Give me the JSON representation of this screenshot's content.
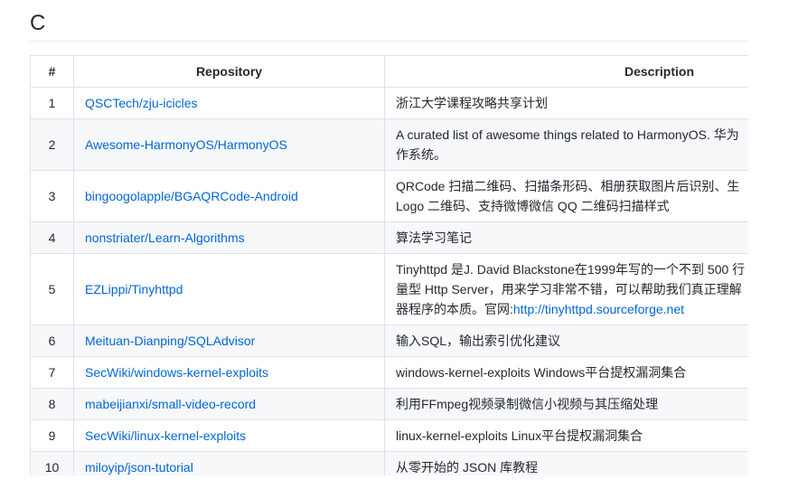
{
  "section": {
    "title": "C"
  },
  "table": {
    "headers": {
      "num": "#",
      "repo": "Repository",
      "desc": "Description"
    },
    "rows": [
      {
        "num": "1",
        "repo": "QSCTech/zju-icicles",
        "desc_lines": [
          "浙江大学课程攻略共享计划"
        ]
      },
      {
        "num": "2",
        "repo": "Awesome-HarmonyOS/HarmonyOS",
        "desc_lines": [
          "A curated list of awesome things related to HarmonyOS. 华为",
          "作系统。"
        ]
      },
      {
        "num": "3",
        "repo": "bingoogolapple/BGAQRCode-Android",
        "desc_lines": [
          "QRCode 扫描二维码、扫描条形码、相册获取图片后识别、生",
          "Logo 二维码、支持微博微信 QQ 二维码扫描样式"
        ]
      },
      {
        "num": "4",
        "repo": "nonstriater/Learn-Algorithms",
        "desc_lines": [
          "算法学习笔记"
        ]
      },
      {
        "num": "5",
        "repo": "EZLippi/Tinyhttpd",
        "desc_lines": [
          "Tinyhttpd 是J. David Blackstone在1999年写的一个不到 500 行",
          "量型 Http Server，用来学习非常不错，可以帮助我们真正理解",
          "器程序的本质。官网:"
        ],
        "desc_link": "http://tinyhttpd.sourceforge.net"
      },
      {
        "num": "6",
        "repo": "Meituan-Dianping/SQLAdvisor",
        "desc_lines": [
          "输入SQL，输出索引优化建议"
        ]
      },
      {
        "num": "7",
        "repo": "SecWiki/windows-kernel-exploits",
        "desc_lines": [
          "windows-kernel-exploits Windows平台提权漏洞集合"
        ]
      },
      {
        "num": "8",
        "repo": "mabeijianxi/small-video-record",
        "desc_lines": [
          "利用FFmpeg视频录制微信小视频与其压缩处理"
        ]
      },
      {
        "num": "9",
        "repo": "SecWiki/linux-kernel-exploits",
        "desc_lines": [
          "linux-kernel-exploits Linux平台提权漏洞集合"
        ]
      },
      {
        "num": "10",
        "repo": "miloyip/json-tutorial",
        "desc_lines": [
          "从零开始的 JSON 库教程"
        ]
      }
    ]
  },
  "colors": {
    "link": "#0366d6",
    "text": "#24292e",
    "border": "#dfe2e5",
    "stripe": "#f6f8fa"
  }
}
